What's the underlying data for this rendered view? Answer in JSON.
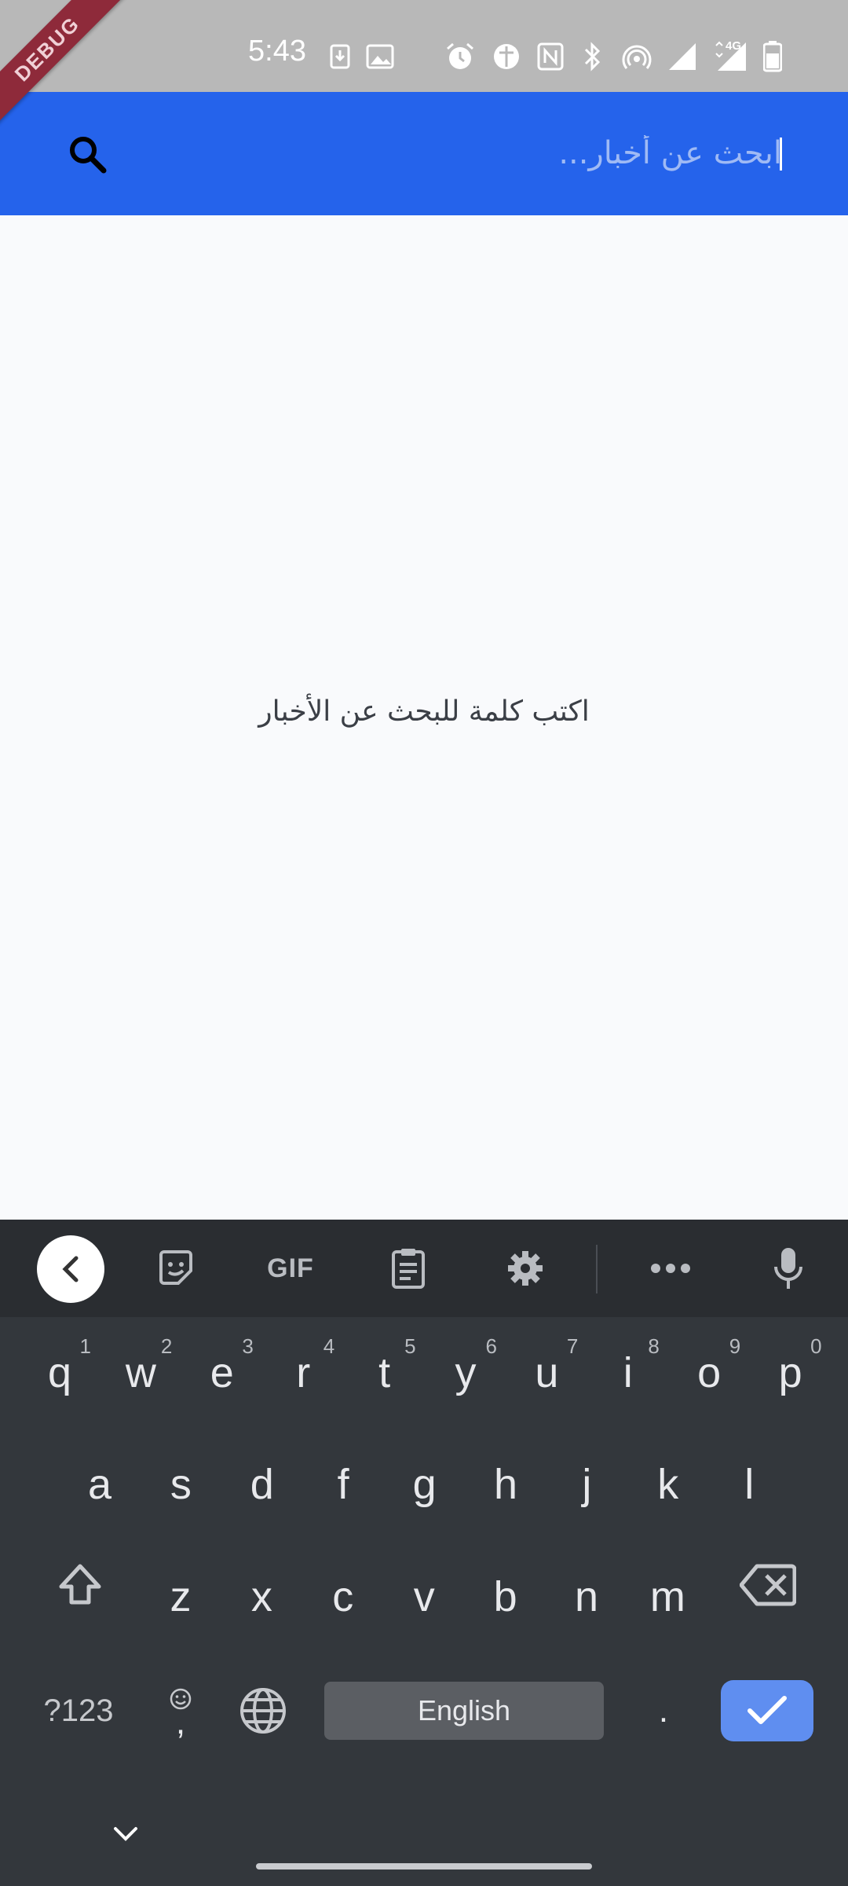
{
  "status_bar": {
    "time": "5:43",
    "icons": [
      "download-icon",
      "image-icon",
      "alarm-icon",
      "vpn-icon",
      "nfc-icon",
      "bluetooth-icon",
      "hotspot-icon",
      "signal-icon",
      "signal-4g-icon",
      "battery-icon"
    ],
    "network_label": "4G"
  },
  "debug_banner": "DEBUG",
  "search": {
    "placeholder": "ابحث عن أخبار...",
    "value": ""
  },
  "empty_state": {
    "message": "اكتب كلمة للبحث عن الأخبار"
  },
  "keyboard": {
    "toolbar": {
      "gif_label": "GIF"
    },
    "row1": [
      {
        "key": "q",
        "hint": "1"
      },
      {
        "key": "w",
        "hint": "2"
      },
      {
        "key": "e",
        "hint": "3"
      },
      {
        "key": "r",
        "hint": "4"
      },
      {
        "key": "t",
        "hint": "5"
      },
      {
        "key": "y",
        "hint": "6"
      },
      {
        "key": "u",
        "hint": "7"
      },
      {
        "key": "i",
        "hint": "8"
      },
      {
        "key": "o",
        "hint": "9"
      },
      {
        "key": "p",
        "hint": "0"
      }
    ],
    "row2": [
      "a",
      "s",
      "d",
      "f",
      "g",
      "h",
      "j",
      "k",
      "l"
    ],
    "row3": [
      "z",
      "x",
      "c",
      "v",
      "b",
      "n",
      "m"
    ],
    "symbols_label": "?123",
    "comma_label": ",",
    "space_label": "English",
    "period_label": "."
  },
  "colors": {
    "app_bar": "#2563eb",
    "background": "#f9fafc",
    "keyboard": "#33373c",
    "accent_enter": "#5f8ef0"
  }
}
